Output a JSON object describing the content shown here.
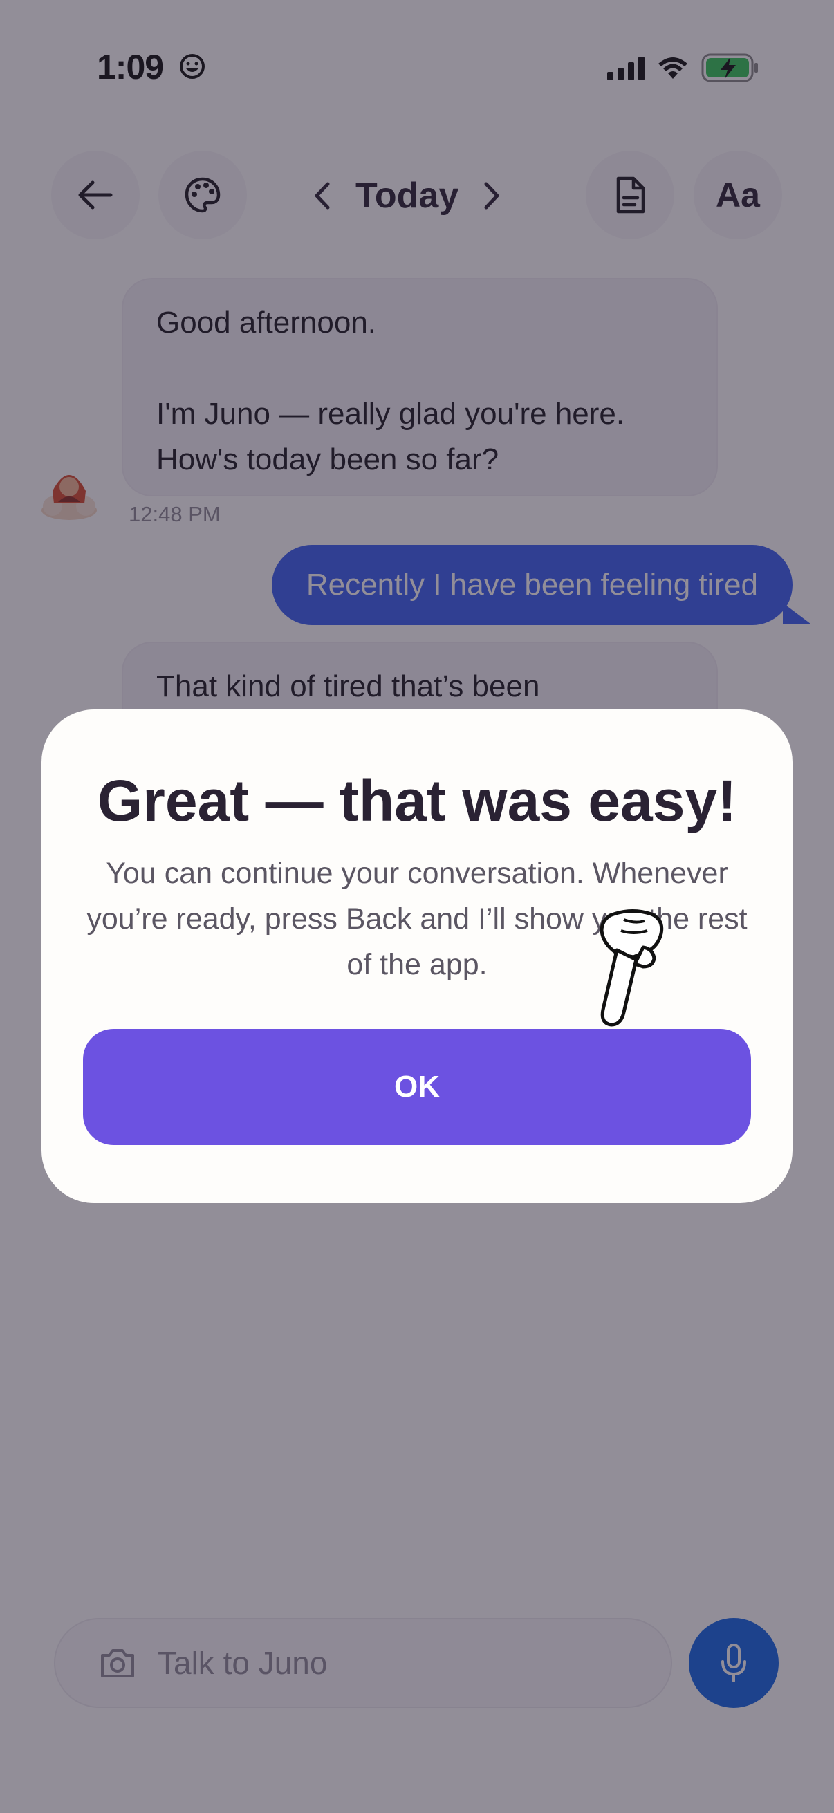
{
  "status_bar": {
    "time": "1:09",
    "icons": [
      "smiley-icon",
      "signal-icon",
      "wifi-icon",
      "battery-charging-icon"
    ]
  },
  "header": {
    "back_icon": "back-arrow-icon",
    "palette_icon": "palette-icon",
    "prev_icon": "chevron-left-icon",
    "date_label": "Today",
    "next_icon": "chevron-right-icon",
    "document_icon": "document-icon",
    "font_label": "Aa"
  },
  "chat": {
    "messages": [
      {
        "sender": "Juno",
        "lines": [
          "Good afternoon.",
          "",
          "I'm Juno — really glad you're here.",
          "How's today been so far?"
        ],
        "time": "12:48 PM"
      },
      {
        "sender": "user",
        "text": "Recently I have been feeling tired"
      },
      {
        "sender": "Juno",
        "text": "That kind of tired that’s been"
      }
    ]
  },
  "composer": {
    "camera_icon": "camera-icon",
    "placeholder": "Talk to Juno",
    "mic_icon": "microphone-icon"
  },
  "modal": {
    "title": "Great — that was easy!",
    "body": "You can continue your conversation. Whenever you’re ready, press Back and I’ll show you the rest of the app.",
    "ok_label": "OK",
    "pointer_icon": "pointing-hand-icon"
  },
  "colors": {
    "accent_purple": "#6c52e1",
    "user_bubble_blue": "#3b61f2",
    "mic_blue": "#1467e6",
    "overlay": "rgba(38,30,50,0.5)"
  }
}
